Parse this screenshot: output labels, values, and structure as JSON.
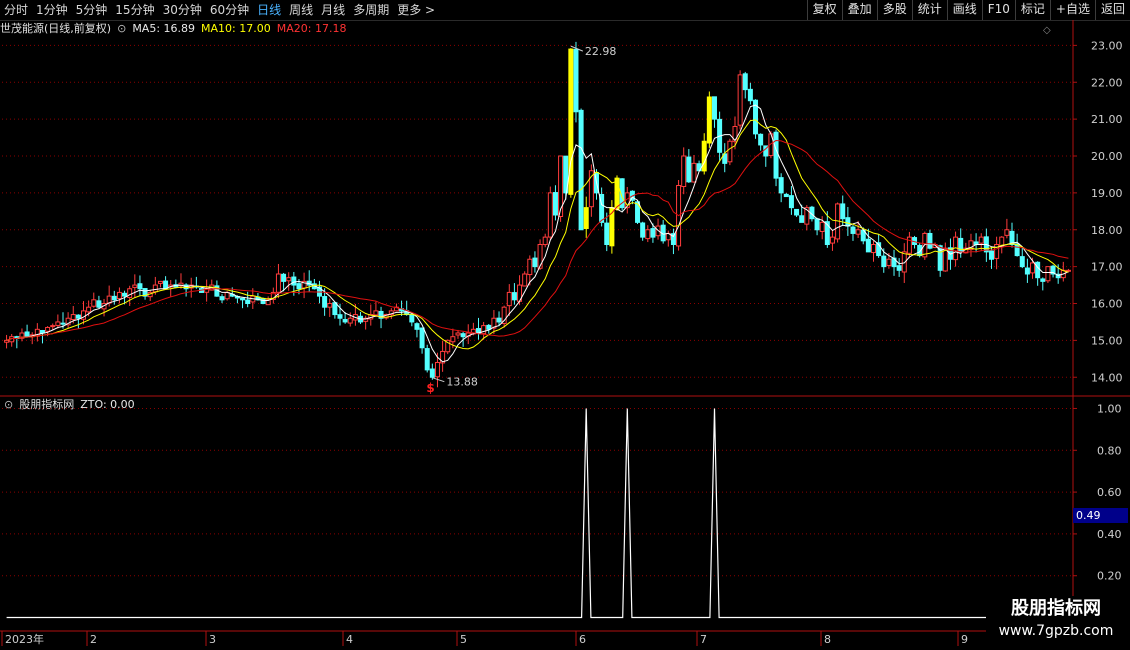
{
  "toolbar": {
    "periods": [
      "分时",
      "1分钟",
      "5分钟",
      "15分钟",
      "30分钟",
      "60分钟",
      "日线",
      "周线",
      "月线",
      "多周期",
      "更多 >"
    ],
    "active": "日线",
    "buttons": [
      "复权",
      "叠加",
      "多股",
      "统计",
      "画线",
      "F10",
      "标记",
      "+自选",
      "返回"
    ]
  },
  "main_legend": {
    "title": "世茂能源(日线,前复权)",
    "ma5": "MA5: 16.89",
    "ma10": "MA10: 17.00",
    "ma20": "MA20: 17.18"
  },
  "indicator_legend": {
    "title": "股朋指标网",
    "zto": "ZTO: 0.00"
  },
  "value_box": "0.49",
  "watermark": {
    "line1": "股朋指标网",
    "line2": "www.7gpzb.com"
  },
  "colors": {
    "up": "#ff3c3c",
    "down": "#54ffff",
    "signal": "#ffff00",
    "ma5": "#ffffff",
    "ma10": "#ffff00",
    "ma20": "#e01010",
    "grid": "#8b0000"
  },
  "chart_data": [
    {
      "type": "candlestick",
      "title": "世茂能源(日线,前复权)",
      "y_ticks": [
        "23.00",
        "22.00",
        "21.00",
        "20.00",
        "19.00",
        "18.00",
        "17.00",
        "16.00",
        "15.00",
        "14.00"
      ],
      "ylim": [
        13.6,
        23.2
      ],
      "x_ticks": [
        "2023年",
        "2",
        "3",
        "4",
        "5",
        "6",
        "7",
        "8",
        "9"
      ],
      "annotations": {
        "high": "22.98",
        "low": "13.88"
      },
      "signal_marker": "$",
      "close": [
        15.0,
        15.1,
        15.05,
        15.2,
        15.1,
        15.15,
        15.3,
        15.2,
        15.35,
        15.4,
        15.5,
        15.45,
        15.6,
        15.7,
        15.6,
        15.8,
        15.9,
        16.1,
        15.9,
        16.0,
        16.2,
        16.1,
        16.3,
        16.2,
        16.4,
        16.5,
        16.4,
        16.2,
        16.3,
        16.5,
        16.6,
        16.4,
        16.5,
        16.45,
        16.55,
        16.4,
        16.5,
        16.45,
        16.3,
        16.4,
        16.5,
        16.2,
        16.1,
        16.3,
        16.2,
        16.15,
        16.1,
        16.0,
        16.2,
        16.1,
        16.0,
        16.1,
        16.3,
        16.8,
        16.6,
        16.7,
        16.5,
        16.4,
        16.6,
        16.5,
        16.4,
        16.2,
        15.9,
        16.0,
        15.7,
        15.6,
        15.5,
        15.6,
        15.7,
        15.5,
        15.6,
        15.7,
        15.8,
        15.6,
        15.7,
        15.8,
        15.9,
        15.8,
        15.7,
        15.5,
        15.3,
        14.8,
        14.2,
        14.0,
        14.4,
        14.7,
        15.0,
        15.1,
        15.2,
        15.1,
        15.2,
        15.3,
        15.2,
        15.4,
        15.3,
        15.6,
        15.5,
        15.9,
        16.3,
        16.1,
        16.5,
        16.8,
        17.2,
        17.0,
        17.6,
        17.8,
        19.0,
        18.4,
        20.0,
        19.0,
        22.9,
        21.2,
        18.0,
        18.6,
        19.6,
        19.0,
        18.2,
        17.6,
        18.6,
        19.4,
        18.6,
        19.0,
        18.8,
        18.2,
        17.8,
        18.0,
        17.8,
        18.1,
        17.7,
        17.9,
        17.6,
        19.2,
        20.0,
        19.3,
        19.8,
        19.6,
        20.4,
        21.6,
        21.0,
        20.1,
        19.8,
        20.4,
        20.8,
        22.2,
        21.8,
        21.5,
        20.6,
        20.3,
        20.0,
        20.6,
        19.4,
        19.0,
        18.9,
        18.6,
        18.4,
        18.2,
        18.6,
        18.3,
        18.0,
        18.2,
        17.6,
        17.8,
        18.7,
        18.3,
        18.1,
        17.9,
        18.0,
        17.7,
        17.4,
        17.6,
        17.3,
        17.0,
        17.2,
        17.0,
        16.9,
        17.4,
        17.8,
        17.6,
        17.3,
        17.9,
        17.5,
        17.6,
        16.9,
        17.5,
        17.2,
        17.8,
        17.4,
        17.5,
        17.7,
        17.6,
        17.8,
        17.4,
        17.2,
        17.6,
        17.8,
        18.0,
        17.6,
        17.3,
        17.0,
        16.8,
        17.1,
        16.7,
        16.6,
        17.0,
        16.8,
        16.7,
        16.9,
        16.9
      ]
    },
    {
      "type": "line",
      "title": "股朋指标网",
      "series": [
        {
          "name": "ZTO",
          "spikes_at": [
            113,
            121,
            138
          ],
          "spike_value": 1.0,
          "base_value": 0.0
        }
      ],
      "y_ticks": [
        "1.00",
        "0.80",
        "0.60",
        "0.40",
        "0.20"
      ],
      "ylim": [
        -0.05,
        1.05
      ]
    }
  ]
}
